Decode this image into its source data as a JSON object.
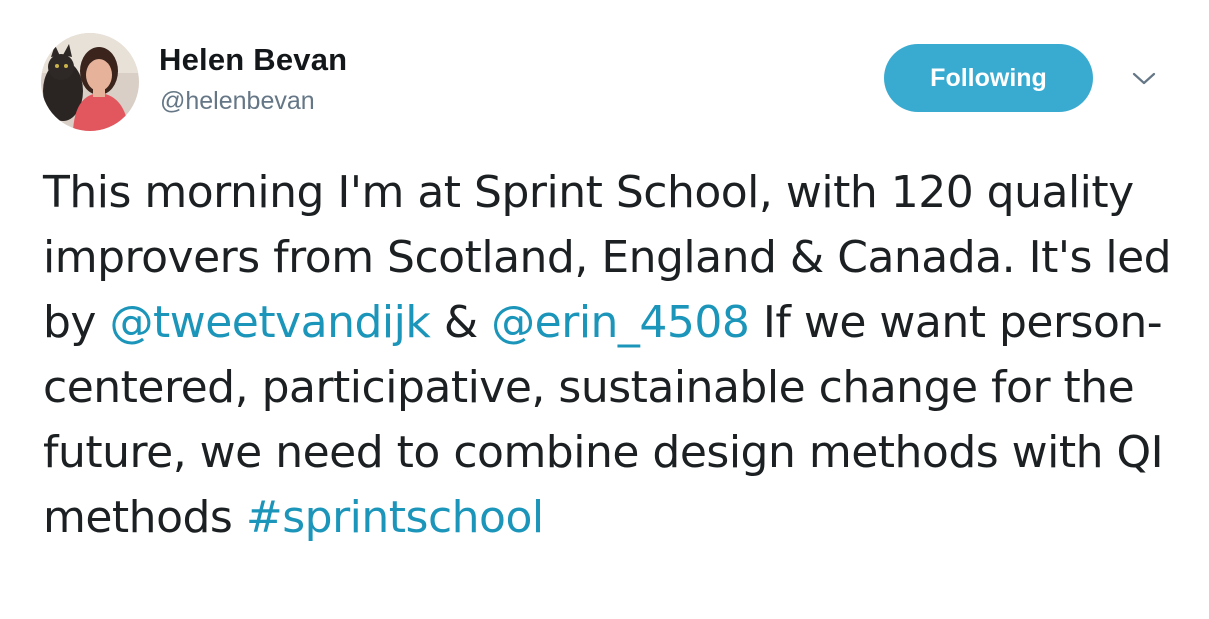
{
  "author": {
    "name": "Helen Bevan",
    "handle": "@helenbevan",
    "avatar_icon": "profile-photo"
  },
  "follow_button": {
    "label": "Following",
    "color": "#3aabd0"
  },
  "menu": {
    "icon": "chevron-down-icon"
  },
  "tweet": {
    "seg1": "This morning I'm at Sprint School, with 120 quality improvers from Scotland, England & Canada. It's led by ",
    "mention1": "@tweetvandijk",
    "seg2": " & ",
    "mention2": "@erin_4508",
    "seg3": " If we want person-centered, participative, sustainable change for the future, we need to combine design methods with QI methods ",
    "hashtag": "#sprintschool",
    "link_color": "#1b95b9"
  }
}
